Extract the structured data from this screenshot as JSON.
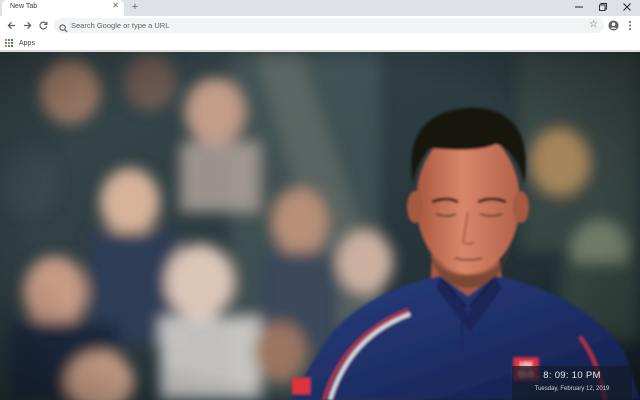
{
  "browser": {
    "tab": {
      "title": "New Tab"
    },
    "new_tab_symbol": "+",
    "omnibox": {
      "placeholder": "Search Google or type a URL"
    },
    "bookmarks": [
      {
        "label": "Apps",
        "icon": "apps-grid-icon"
      }
    ],
    "icons": [
      "back-arrow-icon",
      "forward-arrow-icon",
      "reload-icon",
      "search-icon",
      "star-icon",
      "account-icon",
      "menu-dots-icon",
      "minimize-icon",
      "maximize-icon",
      "close-icon"
    ]
  },
  "wallpaper": {
    "subject": "tennis player in navy shirt with red trim in front of blurred crowd",
    "shirt_logo": "UNI QLO",
    "palette": {
      "shirt": "#1f2f66",
      "crowd": "#2a3a40",
      "skin": "#c9775a",
      "logo": "#e0323c"
    }
  },
  "clock": {
    "time": "8: 09: 10 PM",
    "date": "Tuesday, February 12, 2019"
  }
}
